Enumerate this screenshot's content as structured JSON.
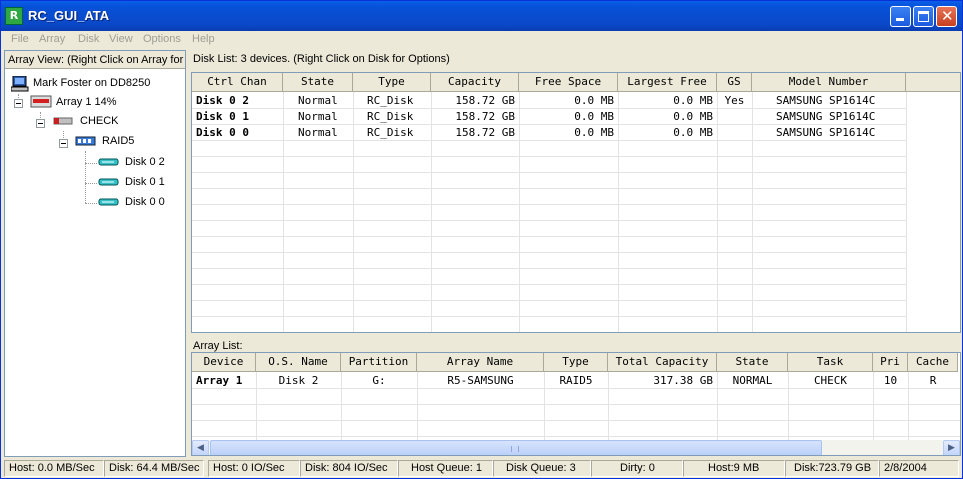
{
  "window": {
    "title": "RC_GUI_ATA",
    "icon_glyph": "R"
  },
  "menu": [
    "File",
    "Array",
    "Disk",
    "View",
    "Options",
    "Help"
  ],
  "array_view": {
    "header": "Array View:  (Right Click on Array for",
    "host": "Mark Foster on DD8250",
    "array": "Array 1  14%",
    "check": "CHECK",
    "raid": "RAID5",
    "disks": [
      "Disk  0 2",
      "Disk  0 1",
      "Disk  0 0"
    ]
  },
  "disk_list": {
    "header": "Disk List: 3 devices.  (Right Click on Disk for Options)",
    "columns": [
      "Ctrl Chan",
      "State",
      "Type",
      "Capacity",
      "Free Space",
      "Largest Free",
      "GS",
      "Model Number"
    ],
    "rows": [
      {
        "dev": "Disk  0 2",
        "state": "Normal",
        "type": "RC_Disk",
        "cap": "158.72 GB",
        "free": "0.0 MB",
        "largest": "0.0 MB",
        "gs": "Yes",
        "model": "SAMSUNG SP1614C"
      },
      {
        "dev": "Disk  0 1",
        "state": "Normal",
        "type": "RC_Disk",
        "cap": "158.72 GB",
        "free": "0.0 MB",
        "largest": "0.0 MB",
        "gs": "",
        "model": "SAMSUNG SP1614C"
      },
      {
        "dev": "Disk  0 0",
        "state": "Normal",
        "type": "RC_Disk",
        "cap": "158.72 GB",
        "free": "0.0 MB",
        "largest": "0.0 MB",
        "gs": "",
        "model": "SAMSUNG SP1614C"
      }
    ]
  },
  "array_list": {
    "header": "Array List:",
    "columns": [
      "Device",
      "O.S. Name",
      "Partition",
      "Array Name",
      "Type",
      "Total Capacity",
      "State",
      "Task",
      "Pri",
      "Cache"
    ],
    "rows": [
      {
        "device": "Array 1",
        "os": "Disk 2",
        "part": "G:",
        "name": "R5-SAMSUNG",
        "type": "RAID5",
        "cap": "317.38 GB",
        "state": "NORMAL",
        "task": "CHECK",
        "pri": "10",
        "cache": "R"
      }
    ]
  },
  "status": [
    "Host: 0.0 MB/Sec",
    "Disk: 64.4 MB/Sec",
    "Host: 0 IO/Sec",
    "Disk: 804 IO/Sec",
    "Host Queue: 1",
    "Disk Queue: 3",
    "Dirty: 0",
    "Host:9 MB",
    "Disk:723.79 GB",
    "2/8/2004"
  ]
}
